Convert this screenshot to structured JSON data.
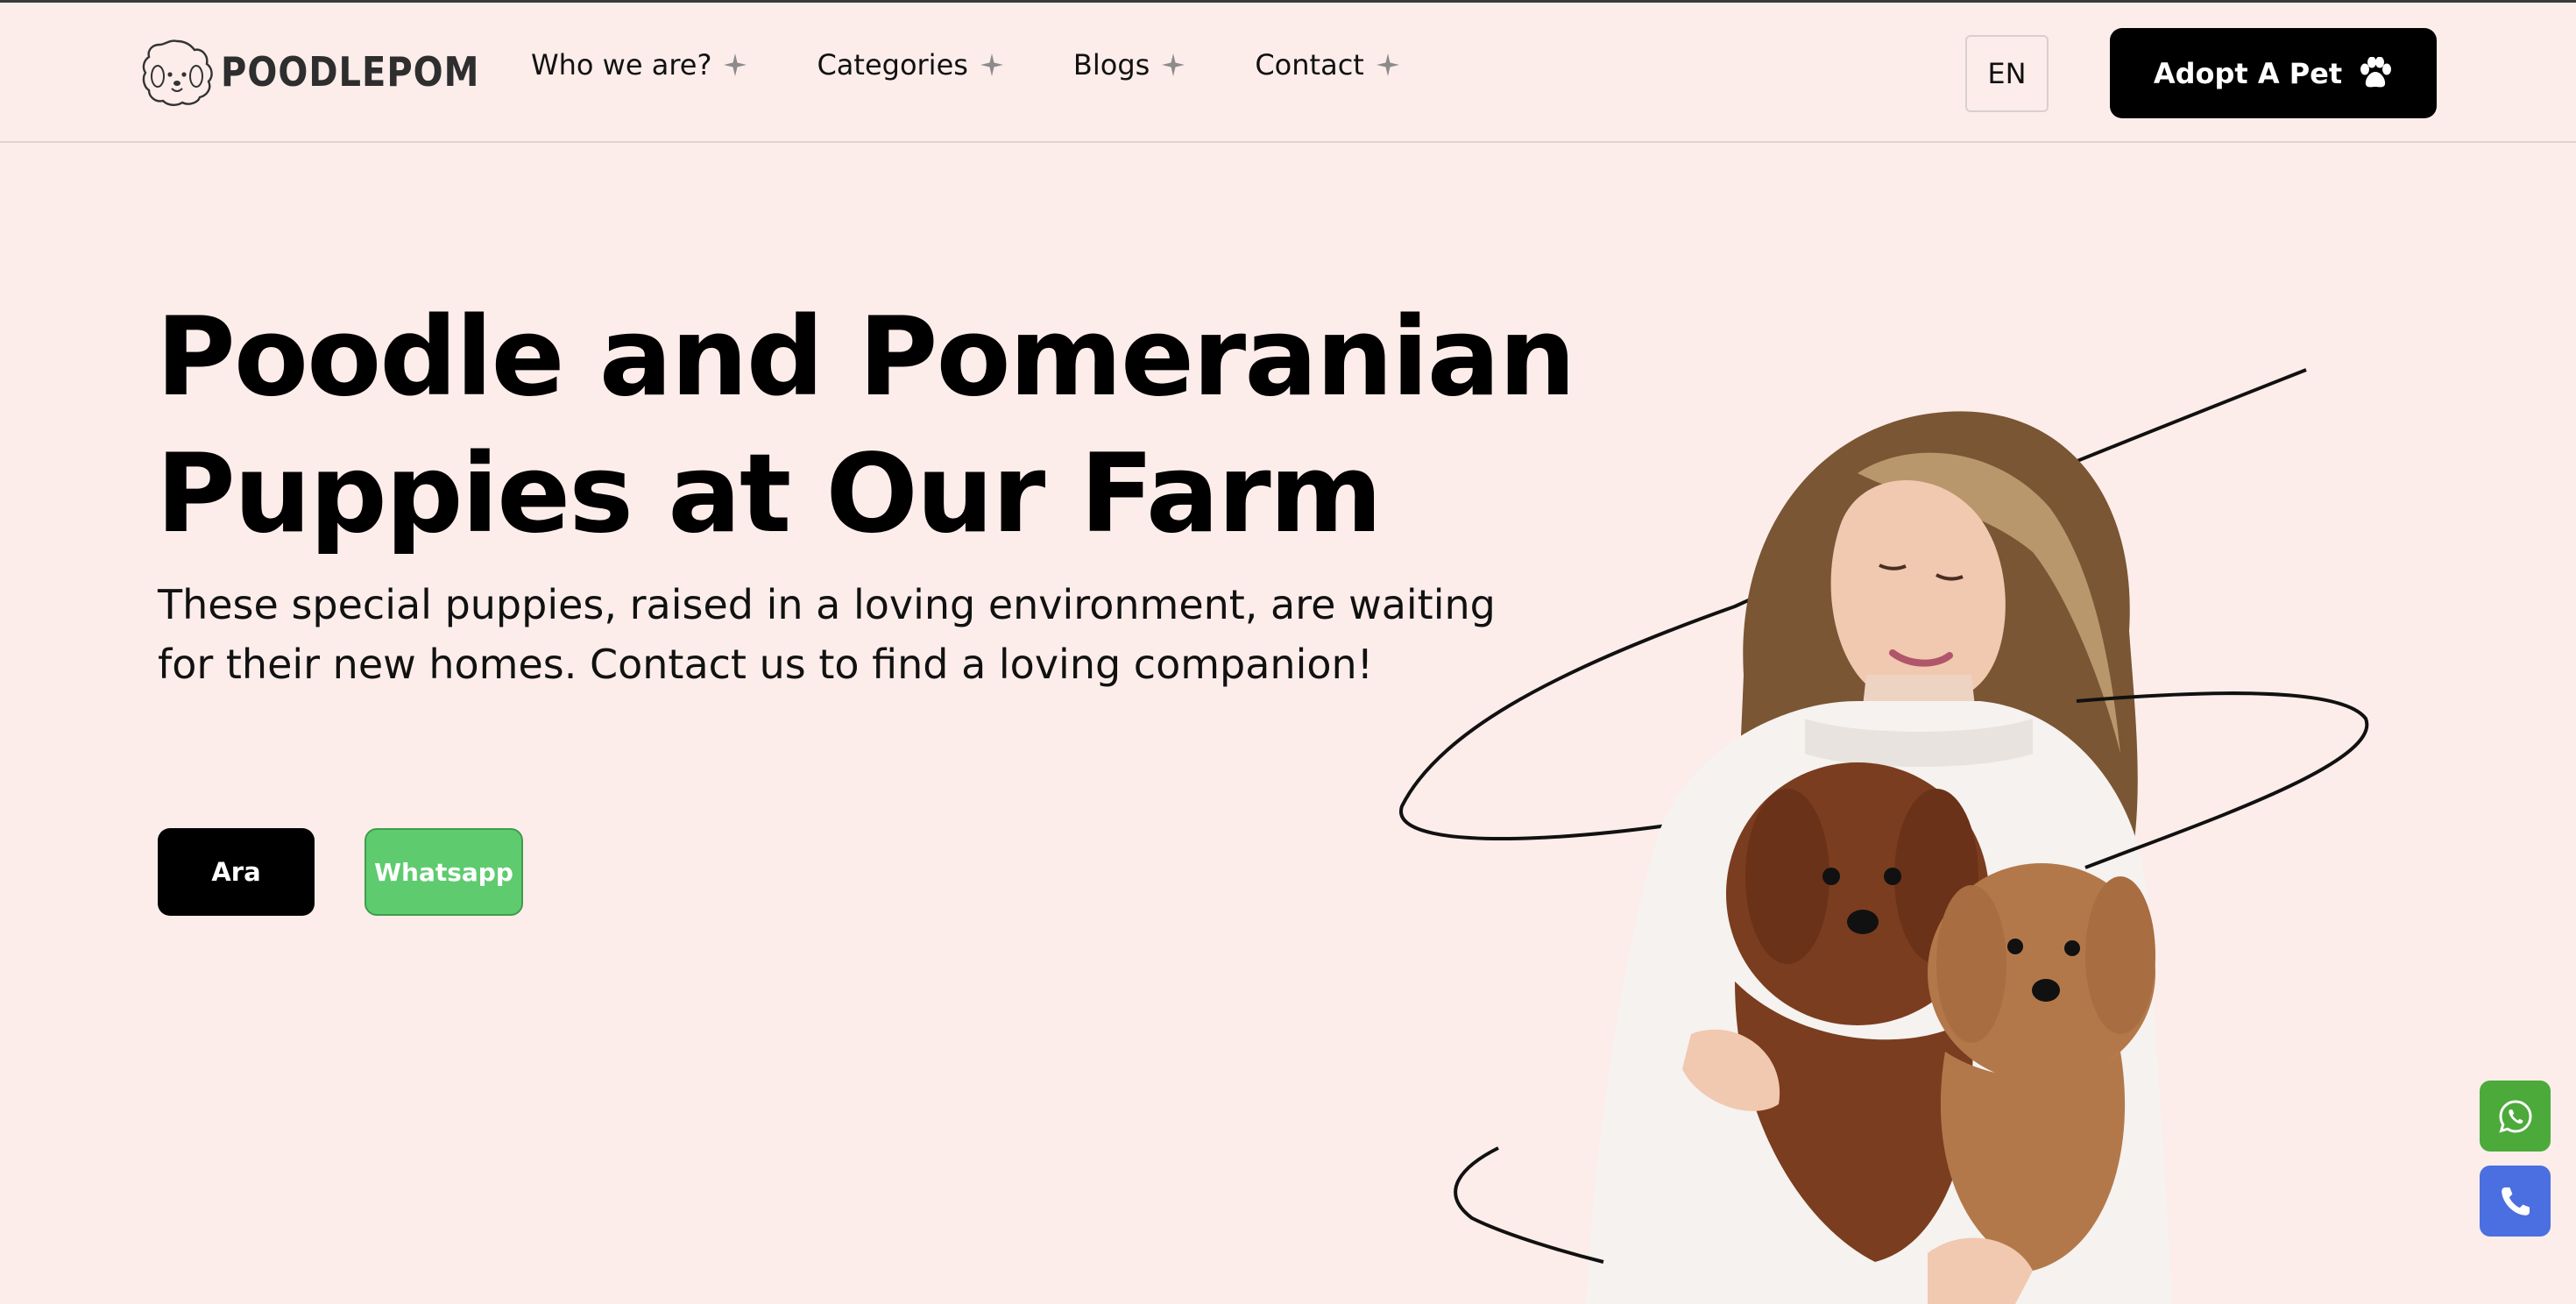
{
  "brand": {
    "name": "POODLEPOM",
    "logo_icon": "poodle-face-icon"
  },
  "nav": {
    "items": [
      {
        "label": "Who we are?",
        "icon": "sparkle-icon"
      },
      {
        "label": "Categories",
        "icon": "sparkle-icon"
      },
      {
        "label": "Blogs",
        "icon": "sparkle-icon"
      },
      {
        "label": "Contact",
        "icon": "sparkle-icon"
      }
    ]
  },
  "language": {
    "label": "EN"
  },
  "adopt_button": {
    "label": "Adopt A Pet",
    "icon": "paw-icon"
  },
  "hero": {
    "title_line1": "Poodle and Pomeranian",
    "title_line2": "Puppies at Our Farm",
    "subtitle": "These special puppies, raised in a loving environment, are waiting for their new homes. Contact us to find a loving companion!",
    "cta_primary": "Ara",
    "cta_secondary": "Whatsapp",
    "image_icon": "woman-holding-puppies-photo"
  },
  "floating": {
    "whatsapp_icon": "whatsapp-icon",
    "phone_icon": "phone-icon"
  },
  "colors": {
    "background": "#fcedea",
    "primary": "#000000",
    "whatsapp_green": "#5ecb6f",
    "float_green": "#4caa3a",
    "float_blue": "#4b6fe0"
  }
}
